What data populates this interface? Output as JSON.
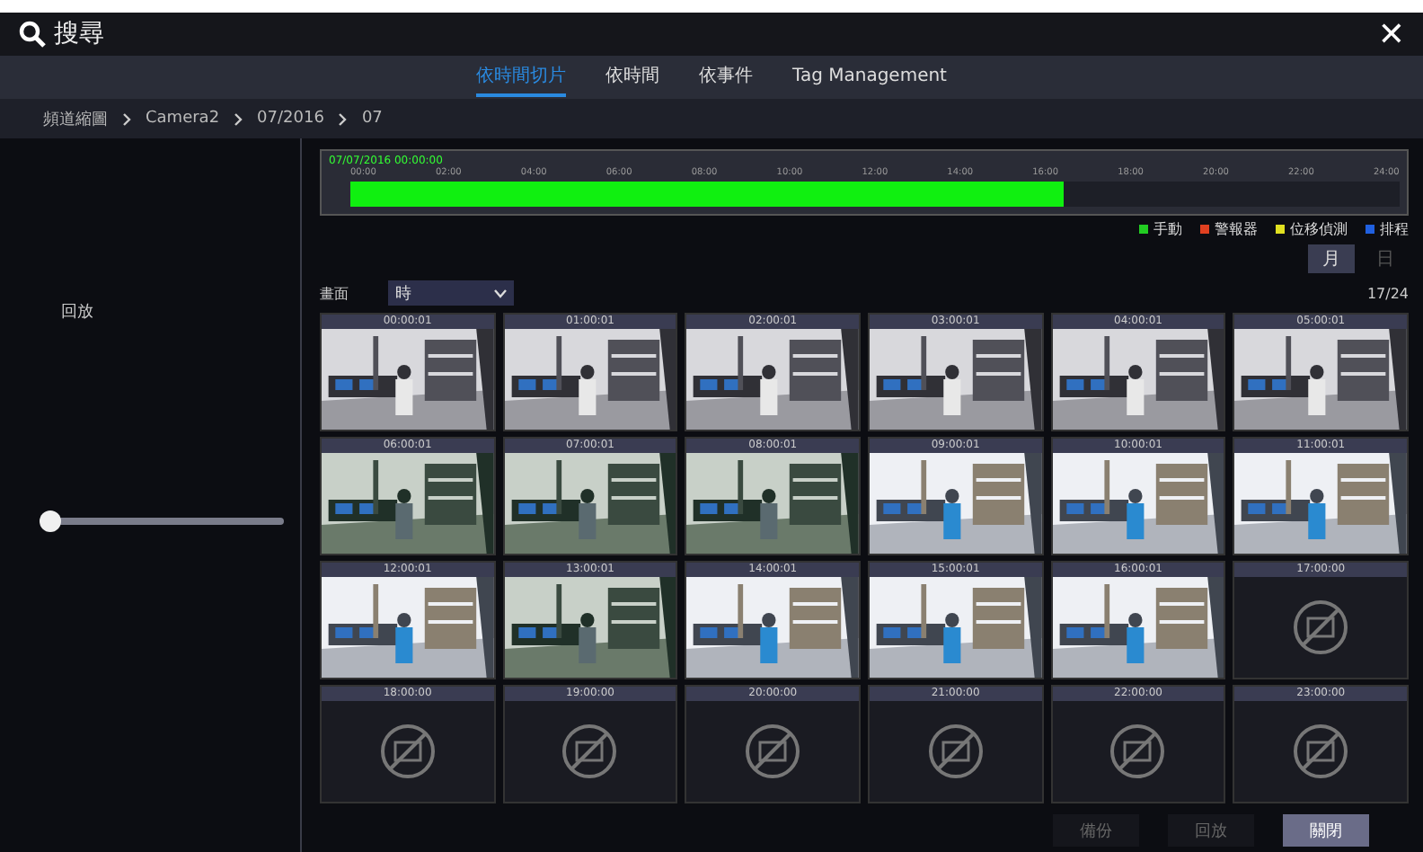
{
  "window": {
    "title": "搜尋",
    "close": "✕"
  },
  "tabs": [
    {
      "label": "依時間切片",
      "selected": true
    },
    {
      "label": "依時間",
      "selected": false
    },
    {
      "label": "依事件",
      "selected": false
    },
    {
      "label": "Tag Management",
      "selected": false
    }
  ],
  "breadcrumb": [
    "頻道縮圖",
    "Camera2",
    "07/2016",
    "07"
  ],
  "sidebar": {
    "label": "回放",
    "slider": {
      "level": 0
    }
  },
  "timeline": {
    "start": "07/07/2016 00:00:00",
    "ticks": [
      "00:00",
      "02:00",
      "04:00",
      "06:00",
      "08:00",
      "10:00",
      "12:00",
      "14:00",
      "16:00",
      "18:00",
      "20:00",
      "22:00",
      "24:00"
    ],
    "level": 0.68
  },
  "legend": [
    {
      "label": "手動",
      "color": "#22cc22"
    },
    {
      "label": "警報器",
      "color": "#e04020"
    },
    {
      "label": "位移偵測",
      "color": "#e0e020"
    },
    {
      "label": "排程",
      "color": "#2060e0"
    }
  ],
  "scale_buttons": [
    {
      "label": "月",
      "selected": true
    },
    {
      "label": "日",
      "selected": false
    }
  ],
  "view": {
    "label": "畫面",
    "value": "時",
    "count": "17/24"
  },
  "thumbnails": [
    {
      "time": "00:00:01",
      "kind": "night"
    },
    {
      "time": "01:00:01",
      "kind": "night"
    },
    {
      "time": "02:00:01",
      "kind": "night"
    },
    {
      "time": "03:00:01",
      "kind": "night"
    },
    {
      "time": "04:00:01",
      "kind": "night"
    },
    {
      "time": "05:00:01",
      "kind": "night"
    },
    {
      "time": "06:00:01",
      "kind": "dawn"
    },
    {
      "time": "07:00:01",
      "kind": "dawn"
    },
    {
      "time": "08:00:01",
      "kind": "dawn"
    },
    {
      "time": "09:00:01",
      "kind": "day"
    },
    {
      "time": "10:00:01",
      "kind": "day"
    },
    {
      "time": "11:00:01",
      "kind": "day"
    },
    {
      "time": "12:00:01",
      "kind": "day"
    },
    {
      "time": "13:00:01",
      "kind": "dawn"
    },
    {
      "time": "14:00:01",
      "kind": "day"
    },
    {
      "time": "15:00:01",
      "kind": "day"
    },
    {
      "time": "16:00:01",
      "kind": "day"
    },
    {
      "time": "17:00:00",
      "kind": "empty"
    },
    {
      "time": "18:00:00",
      "kind": "empty"
    },
    {
      "time": "19:00:00",
      "kind": "empty"
    },
    {
      "time": "20:00:00",
      "kind": "empty"
    },
    {
      "time": "21:00:00",
      "kind": "empty"
    },
    {
      "time": "22:00:00",
      "kind": "empty"
    },
    {
      "time": "23:00:00",
      "kind": "empty"
    }
  ],
  "buttons": [
    {
      "label": "備份",
      "disabled": true
    },
    {
      "label": "回放",
      "disabled": true
    },
    {
      "label": "關閉",
      "disabled": false
    }
  ]
}
